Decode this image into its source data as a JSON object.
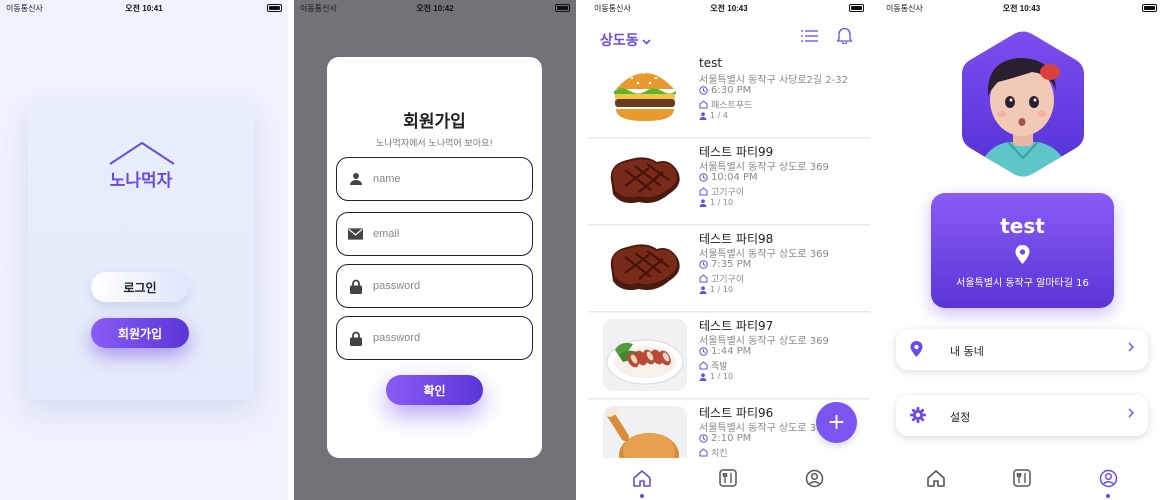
{
  "status_bars": [
    {
      "carrier": "이동통신사",
      "time": "오전 10:41"
    },
    {
      "carrier": "이동통신사",
      "time": "오전 10:42"
    },
    {
      "carrier": "이동통신사",
      "time": "오전 10:43"
    },
    {
      "carrier": "이동통신사",
      "time": "오전 10:43"
    }
  ],
  "welcome": {
    "logo_text": "노나먹자",
    "login_label": "로그인",
    "signup_label": "회원가입"
  },
  "signup": {
    "title": "회원가입",
    "subtitle": "노나먹자에서 노나먹어 보아요!",
    "fields": [
      {
        "icon": "person-icon",
        "placeholder": "name"
      },
      {
        "icon": "mail-icon",
        "placeholder": "email"
      },
      {
        "icon": "lock-icon",
        "placeholder": "password"
      },
      {
        "icon": "lock-icon",
        "placeholder": "password"
      }
    ],
    "confirm_label": "확인"
  },
  "feed": {
    "location": "상도동",
    "parties": [
      {
        "title": "test",
        "address": "서울특별시 동작구 사당로2길 2-32",
        "time": "6:30 PM",
        "category": "패스트푸드",
        "count": "1 / 4",
        "image": "burger"
      },
      {
        "title": "테스트 파티99",
        "address": "서울특별시 동작구 상도로 369",
        "time": "10:04 PM",
        "category": "고기구이",
        "count": "1 / 10",
        "image": "steak"
      },
      {
        "title": "테스트 파티98",
        "address": "서울특별시 동작구 상도로 369",
        "time": "7:35 PM",
        "category": "고기구이",
        "count": "1 / 10",
        "image": "steak"
      },
      {
        "title": "테스트 파티97",
        "address": "서울특별시 동작구 상도로 369",
        "time": "1:44 PM",
        "category": "족발",
        "count": "1 / 10",
        "image": "jokbal"
      },
      {
        "title": "테스트 파티96",
        "address": "서울특별시 동작구 상도로 369",
        "time": "2:10 PM",
        "category": "치킨",
        "count": "",
        "image": "chicken"
      }
    ],
    "fab_label": "+"
  },
  "profile": {
    "name": "test",
    "address": "서울특별시 동작구 알마타길 16",
    "menu": [
      {
        "icon": "location-pin-icon",
        "label": "내 동네"
      },
      {
        "icon": "gear-icon",
        "label": "설정"
      }
    ]
  },
  "colors": {
    "accent": "#6a4be6",
    "accent_dark": "#5a35d6",
    "accent_light": "#8a5cf6"
  }
}
